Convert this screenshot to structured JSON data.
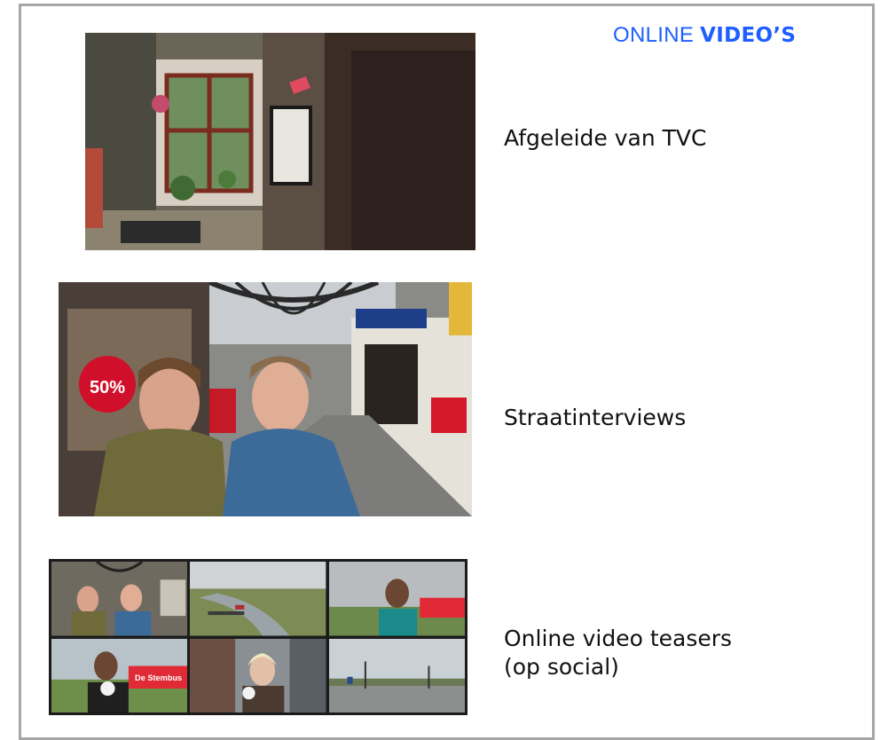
{
  "header": {
    "title_prefix": "ONLINE",
    "title_bold": "VIDEO’S",
    "accent_color": "#1f5fff"
  },
  "items": [
    {
      "caption": "Afgeleide van TVC"
    },
    {
      "caption": "Straatinterviews"
    },
    {
      "caption_line1": "Online video teasers",
      "caption_line2": "(op social)"
    }
  ],
  "images": {
    "tvc_still": {
      "overlay_text": ""
    },
    "interview_still": {
      "sign_text": "50%"
    },
    "teaser_grid": {
      "brand_text": "De Stembus"
    }
  }
}
